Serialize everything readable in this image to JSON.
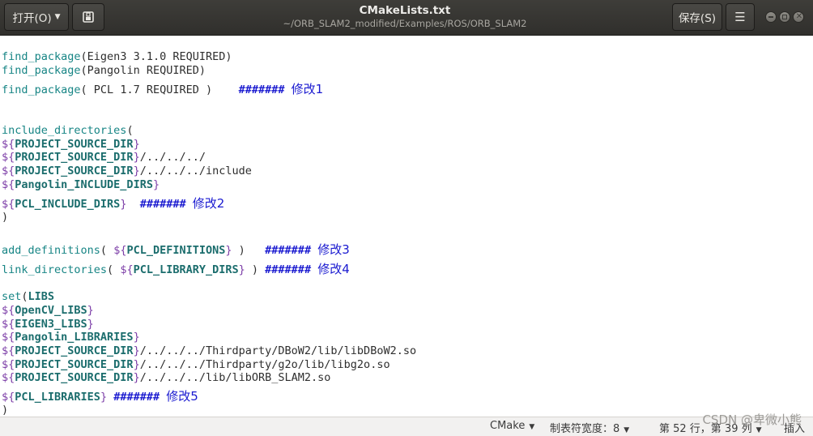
{
  "header": {
    "open_label": "打开(O)",
    "save_label": "保存(S)",
    "title": "CMakeLists.txt",
    "subtitle": "~/ORB_SLAM2_modified/Examples/ROS/ORB_SLAM2",
    "menu_glyph": "☰",
    "history_glyph": "⎗"
  },
  "editor": {
    "l1_fn": "find_package",
    "l1_args": "(Eigen3 3.1.0 REQUIRED)",
    "l2_fn": "find_package",
    "l2_args": "(Pangolin REQUIRED)",
    "l3_fn": "find_package",
    "l3_args": "( PCL 1.7 REQUIRED )",
    "l3_hash": "#######",
    "l3_note": "修改1",
    "l4_fn": "include_directories",
    "l4_paren": "(",
    "l5_var": "PROJECT_SOURCE_DIR",
    "l6_var": "PROJECT_SOURCE_DIR",
    "l6_tail": "/../../../",
    "l7_var": "PROJECT_SOURCE_DIR",
    "l7_tail": "/../../../include",
    "l8_var": "Pangolin_INCLUDE_DIRS",
    "l9_var": "PCL_INCLUDE_DIRS",
    "l9_hash": "#######",
    "l9_note": "修改2",
    "l10_paren": ")",
    "l11_fn": "add_definitions",
    "l11_open": "( ",
    "l11_var": "PCL_DEFINITIONS",
    "l11_close": " )",
    "l11_hash": "#######",
    "l11_note": "修改3",
    "l12_fn": "link_directories",
    "l12_open": "( ",
    "l12_var": "PCL_LIBRARY_DIRS",
    "l12_close": " )",
    "l12_hash": "#######",
    "l12_note": "修改4",
    "l13_fn": "set",
    "l13_open": "(",
    "l13_kw": "LIBS",
    "l14_var": "OpenCV_LIBS",
    "l15_var": "EIGEN3_LIBS",
    "l16_var": "Pangolin_LIBRARIES",
    "l17_var": "PROJECT_SOURCE_DIR",
    "l17_tail": "/../../../Thirdparty/DBoW2/lib/libDBoW2.so",
    "l18_var": "PROJECT_SOURCE_DIR",
    "l18_tail": "/../../../Thirdparty/g2o/lib/libg2o.so",
    "l19_var": "PROJECT_SOURCE_DIR",
    "l19_tail": "/../../../lib/libORB_SLAM2.so",
    "l20_var": "PCL_LIBRARIES",
    "l20_hash": "#######",
    "l20_note": "修改5",
    "l21_paren": ")",
    "brace_open": "${",
    "brace_close": "}"
  },
  "statusbar": {
    "language": "CMake",
    "tab_width": "制表符宽度：8",
    "position": "第 52 行，第 39 列",
    "mode": "插入"
  },
  "watermark": "CSDN @卑微小熊"
}
